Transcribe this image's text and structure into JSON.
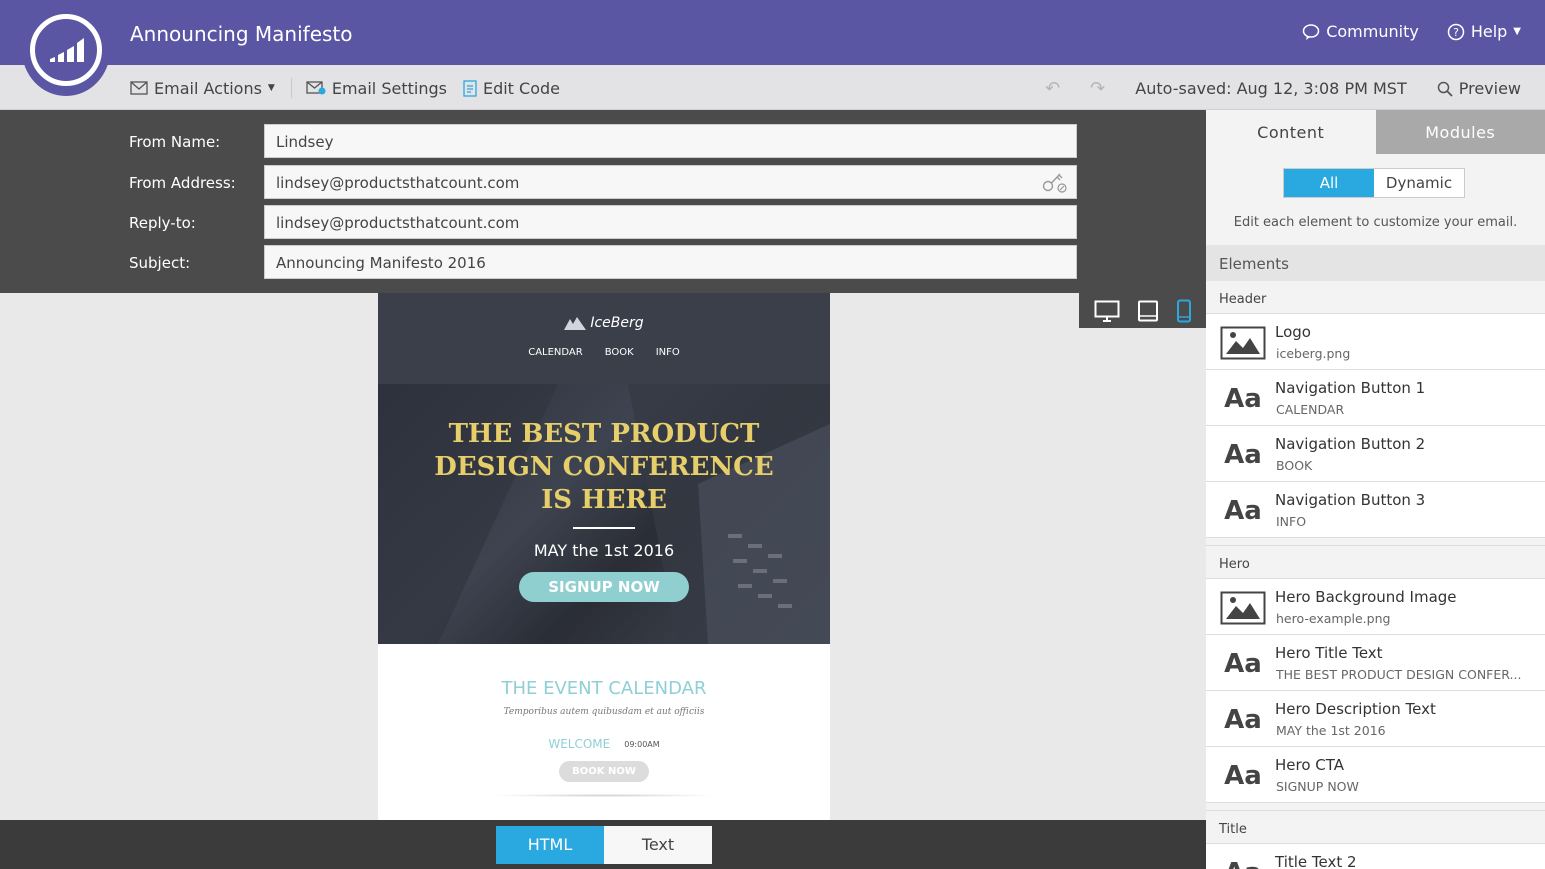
{
  "app": {
    "title": "Announcing Manifesto",
    "community": "Community",
    "help": "Help"
  },
  "toolbar": {
    "email_actions": "Email Actions",
    "email_settings": "Email Settings",
    "edit_code": "Edit Code",
    "autosaved": "Auto-saved: Aug 12, 3:08 PM MST",
    "preview": "Preview"
  },
  "form": {
    "from_name_label": "From Name:",
    "from_name": "Lindsey",
    "from_address_label": "From Address:",
    "from_address": "lindsey@productsthatcount.com",
    "reply_to_label": "Reply-to:",
    "reply_to": "lindsey@productsthatcount.com",
    "subject_label": "Subject:",
    "subject": "Announcing Manifesto 2016"
  },
  "email": {
    "brand": "IceBerg",
    "nav": [
      "CALENDAR",
      "BOOK",
      "INFO"
    ],
    "hero_title_1": "THE BEST PRODUCT",
    "hero_title_2": "DESIGN CONFERENCE",
    "hero_title_3": "IS HERE",
    "hero_date": "MAY the 1st 2016",
    "hero_cta": "SIGNUP NOW",
    "calendar_title": "THE EVENT CALENDAR",
    "calendar_sub": "Temporibus autem quibusdam et aut officiis",
    "welcome": "WELCOME",
    "time": "09:00AM",
    "book_now": "BOOK NOW"
  },
  "bottom_tabs": {
    "html": "HTML",
    "text": "Text"
  },
  "sidebar": {
    "tab_content": "Content",
    "tab_modules": "Modules",
    "filter_all": "All",
    "filter_dynamic": "Dynamic",
    "hint": "Edit each element to customize your email.",
    "elements_title": "Elements",
    "groups": {
      "header": "Header",
      "hero": "Hero",
      "title": "Title"
    },
    "items": [
      {
        "icon": "image-icon",
        "name": "Logo",
        "value": "iceberg.png"
      },
      {
        "icon": "text-icon",
        "name": "Navigation Button 1",
        "value": "CALENDAR"
      },
      {
        "icon": "text-icon",
        "name": "Navigation Button 2",
        "value": "BOOK"
      },
      {
        "icon": "text-icon",
        "name": "Navigation Button 3",
        "value": "INFO"
      },
      {
        "icon": "image-icon",
        "name": "Hero Background Image",
        "value": "hero-example.png"
      },
      {
        "icon": "text-icon",
        "name": "Hero Title Text",
        "value": "THE BEST PRODUCT DESIGN CONFER..."
      },
      {
        "icon": "text-icon",
        "name": "Hero Description Text",
        "value": "MAY the 1st 2016"
      },
      {
        "icon": "text-icon",
        "name": "Hero CTA",
        "value": "SIGNUP NOW"
      },
      {
        "icon": "text-icon",
        "name": "Title Text 2",
        "value": ""
      }
    ],
    "aa_glyph": "Aa"
  },
  "colors": {
    "brand": "#5b56a4",
    "accent": "#2aa8e0",
    "hero_title": "#e6cf6b"
  }
}
